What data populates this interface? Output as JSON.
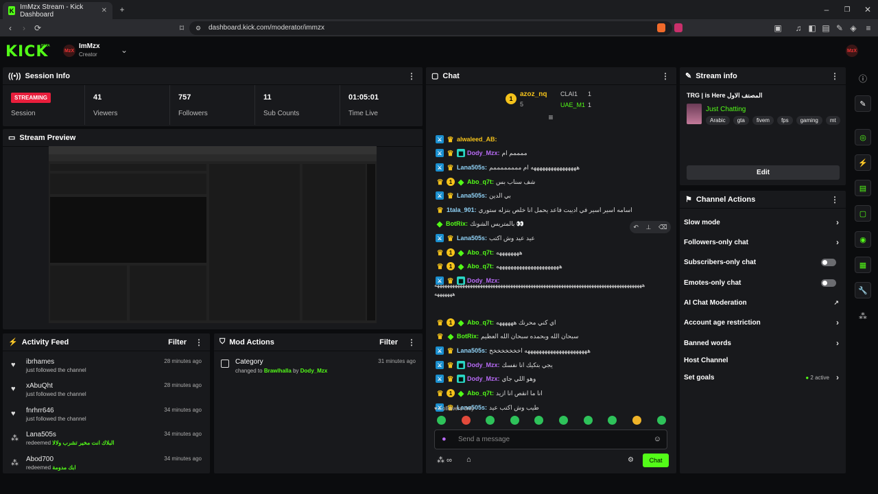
{
  "browser": {
    "tab_title": "ImMzx Stream - Kick Dashboard",
    "url": "dashboard.kick.com/moderator/immzx"
  },
  "header": {
    "logo": "KICK",
    "logo_sup": "BETA",
    "avatar": "MzX",
    "username": "ImMzx",
    "role": "Creator"
  },
  "session": {
    "title": "Session Info",
    "badge": "STREAMING",
    "badge_label": "Session",
    "stats": [
      {
        "value": "41",
        "label": "Viewers"
      },
      {
        "value": "757",
        "label": "Followers"
      },
      {
        "value": "11",
        "label": "Sub Counts"
      },
      {
        "value": "01:05:01",
        "label": "Time Live"
      }
    ]
  },
  "preview": {
    "title": "Stream Preview"
  },
  "activity": {
    "title": "Activity Feed",
    "filter": "Filter",
    "items": [
      {
        "name": "ibrhames",
        "sub": "just followed the channel",
        "time": "28 minutes ago"
      },
      {
        "name": "xAbuQht",
        "sub": "just followed the channel",
        "time": "28 minutes ago"
      },
      {
        "name": "fnrhrr646",
        "sub": "just followed the channel",
        "time": "34 minutes ago"
      },
      {
        "name": "Lana505s",
        "sub": "redeemed",
        "reward": "البلاك انت مخير تشرب ولالا",
        "time": "34 minutes ago"
      },
      {
        "name": "Abod700",
        "sub": "redeemed",
        "reward": "ابك مدومة",
        "time": "34 minutes ago"
      }
    ]
  },
  "modactions": {
    "title": "Mod Actions",
    "filter": "Filter",
    "item": {
      "title": "Category",
      "text": "changed to",
      "game": "Brawlhalla",
      "by": "by",
      "user": "Dody_Mzx",
      "time": "31 minutes ago"
    }
  },
  "chat": {
    "title": "Chat",
    "top": {
      "first": "azoz_nq",
      "first_count": "5",
      "r1": "CLAI1",
      "r1c": "1",
      "r2": "UAE_M1",
      "r2c": "1"
    },
    "lines": [
      {
        "user": "alwaleed_AB:",
        "color": "#f4c21b",
        "msg": ""
      },
      {
        "user": "Dody_Mzx:",
        "color": "#b76af5",
        "msg": "ممممم ام"
      },
      {
        "user": "Lana505s:",
        "color": "#8fd1f5",
        "msg": "ههههههههههههههههه ام ممممممممم"
      },
      {
        "user": "Abo_q7t:",
        "color": "#53fc18",
        "msg": "شف سناب بس"
      },
      {
        "user": "Lana505s:",
        "color": "#8fd1f5",
        "msg": "بي الدين"
      },
      {
        "user": "1tala_901:",
        "color": "#8fd1f5",
        "msg": "اسامه اسير اسير في اديبت فاعد يحمل انا خلص بنزله ستوري"
      },
      {
        "user": "BotRix:",
        "color": "#53fc18",
        "msg": "بالمتريس الشونك 👀"
      },
      {
        "user": "Lana505s:",
        "color": "#8fd1f5",
        "msg": "عيد عيد وش اكتب"
      },
      {
        "user": "Abo_q7t:",
        "color": "#53fc18",
        "msg": "ههههههههه"
      },
      {
        "user": "Abo_q7t:",
        "color": "#53fc18",
        "msg": "ههههههههههههههههههههههه"
      },
      {
        "user": "Dody_Mzx:",
        "color": "#b76af5",
        "msg": ""
      },
      {
        "user": "Abo_q7t:",
        "color": "#53fc18",
        "msg": "اي كني محرنك ههههههه"
      },
      {
        "user": "BotRix:",
        "color": "#53fc18",
        "msg": "سبحان الله وبحمده سبحان الله العظيم"
      },
      {
        "user": "Lana505s:",
        "color": "#8fd1f5",
        "msg": "ههههههههههههههههههههههه اخخخخخخخخ"
      },
      {
        "user": "Dody_Mzx:",
        "color": "#b76af5",
        "msg": "يجي بتكيك انا نفسك"
      },
      {
        "user": "Dody_Mzx:",
        "color": "#b76af5",
        "msg": "وهو اللي جاي"
      },
      {
        "user": "Abo_q7t:",
        "color": "#53fc18",
        "msg": "انا ما انقص انا ازيد"
      },
      {
        "user": "Lana505s:",
        "color": "#8fd1f5",
        "msg": "طيب وش اكتب عيد"
      }
    ],
    "long1": "ههههههههههههههههههههههههههههههههههههههههههههههههههههههههههههههههههههههههههههههههههه",
    "long2": "هههههههه",
    "followers_only": "Followers only",
    "placeholder": "Send a message",
    "send": "Chat"
  },
  "streaminfo": {
    "title": "Stream info",
    "stream_title": "TRG | is Here المصنف الاول",
    "category": "Just Chatting",
    "tags": [
      "Arabic",
      "gta",
      "fivem",
      "fps",
      "gaming",
      "mt"
    ],
    "edit": "Edit"
  },
  "channel_actions": {
    "title": "Channel Actions",
    "items": [
      "Slow mode",
      "Followers-only chat",
      "Subscribers-only chat",
      "Emotes-only chat",
      "AI Chat Moderation",
      "Account age restriction",
      "Banned words",
      "Host Channel",
      "Set goals"
    ],
    "goals_status": "2 active"
  },
  "colors": {
    "accent": "#53fc18",
    "panel": "#18191c",
    "bg": "#0b0c0e",
    "streaming": "#e91e3c"
  }
}
